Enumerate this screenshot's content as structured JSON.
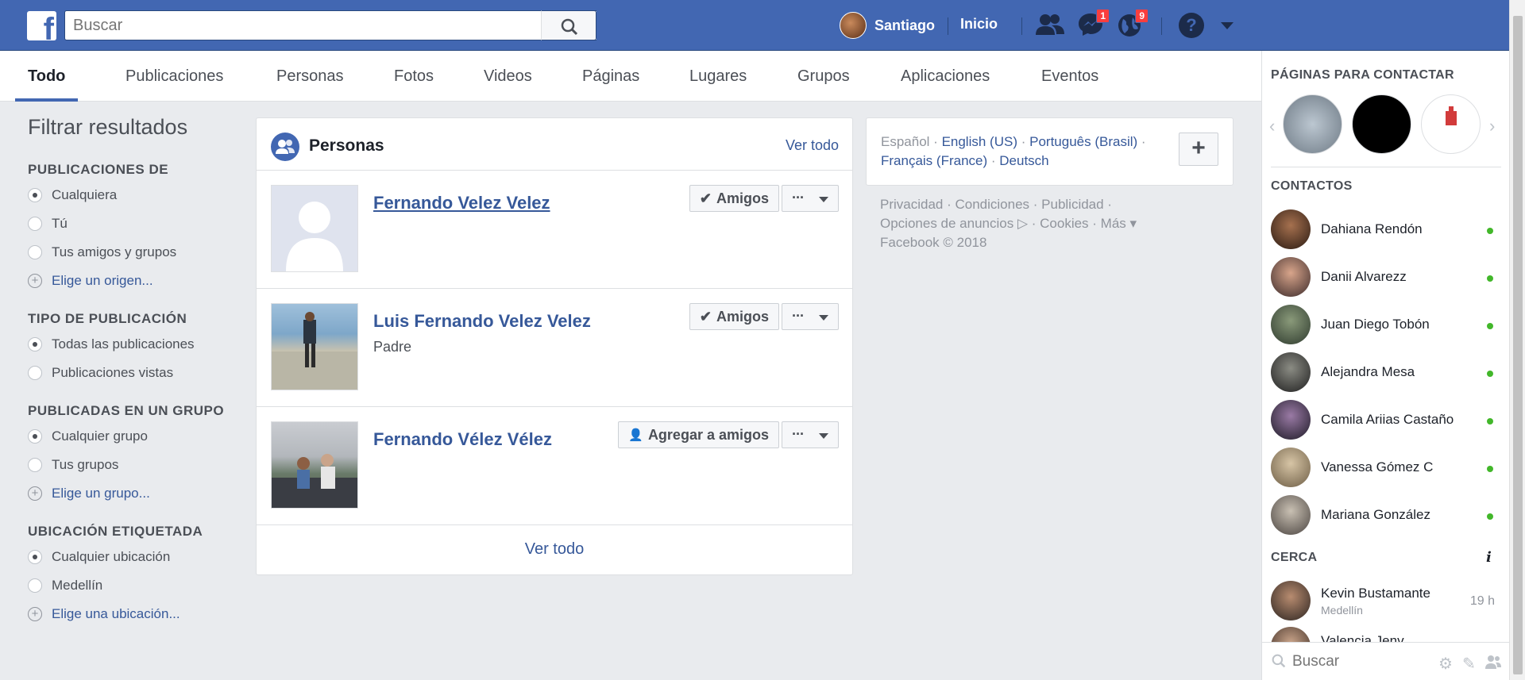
{
  "header": {
    "search_placeholder": "Buscar",
    "profile_name": "Santiago",
    "home_label": "Inicio",
    "messages_badge": "1",
    "notifications_badge": "9"
  },
  "tabs": [
    {
      "label": "Todo",
      "active": true
    },
    {
      "label": "Publicaciones"
    },
    {
      "label": "Personas"
    },
    {
      "label": "Fotos"
    },
    {
      "label": "Videos"
    },
    {
      "label": "Páginas"
    },
    {
      "label": "Lugares"
    },
    {
      "label": "Grupos"
    },
    {
      "label": "Aplicaciones"
    },
    {
      "label": "Eventos"
    }
  ],
  "filters": {
    "title": "Filtrar resultados",
    "sections": [
      {
        "title": "PUBLICACIONES DE",
        "options": [
          "Cualquiera",
          "Tú",
          "Tus amigos y grupos"
        ],
        "selected": 0,
        "link": "Elige un origen..."
      },
      {
        "title": "TIPO DE PUBLICACIÓN",
        "options": [
          "Todas las publicaciones",
          "Publicaciones vistas"
        ],
        "selected": 0
      },
      {
        "title": "PUBLICADAS EN UN GRUPO",
        "options": [
          "Cualquier grupo",
          "Tus grupos"
        ],
        "selected": 0,
        "link": "Elige un grupo..."
      },
      {
        "title": "UBICACIÓN ETIQUETADA",
        "options": [
          "Cualquier ubicación",
          "Medellín"
        ],
        "selected": 0,
        "link": "Elige una ubicación..."
      }
    ]
  },
  "people": {
    "title": "Personas",
    "see_all_top": "Ver todo",
    "see_all_bottom": "Ver todo",
    "results": [
      {
        "name": "Fernando Velez Velez",
        "subtitle": "",
        "action": "Amigos"
      },
      {
        "name": "Luis Fernando Velez Velez",
        "subtitle": "Padre",
        "action": "Amigos"
      },
      {
        "name": "Fernando Vélez Vélez",
        "subtitle": "",
        "action": "Agregar a amigos"
      }
    ],
    "more_label": "···"
  },
  "languages": {
    "current": "Español",
    "others": [
      "English (US)",
      "Português (Brasil)",
      "Français (France)",
      "Deutsch"
    ],
    "add_label": "+"
  },
  "footer": {
    "line1": "Privacidad · Condiciones · Publicidad ·",
    "line2": "Opciones de anuncios ▷ · Cookies · Más ▾",
    "line3": "Facebook © 2018"
  },
  "right_sidebar": {
    "pages_title": "PÁGINAS PARA CONTACTAR",
    "contacts_title": "CONTACTOS",
    "contacts": [
      "Dahiana Rendón",
      "Danii Alvarezz",
      "Juan Diego Tobón",
      "Alejandra Mesa",
      "Camila Ariias Castaño",
      "Vanessa Gómez C",
      "Mariana González"
    ],
    "nearby_title": "CERCA",
    "nearby": [
      {
        "name": "Kevin Bustamante",
        "location": "Medellín",
        "time": "19 h"
      },
      {
        "name": "Valencia Jenv",
        "location": "",
        "time": ""
      }
    ],
    "search_placeholder": "Buscar"
  },
  "colors": {
    "brand_blue": "#4267b2",
    "link_blue": "#365899",
    "online_green": "#42b72a",
    "badge_red": "#fa3e3e"
  }
}
